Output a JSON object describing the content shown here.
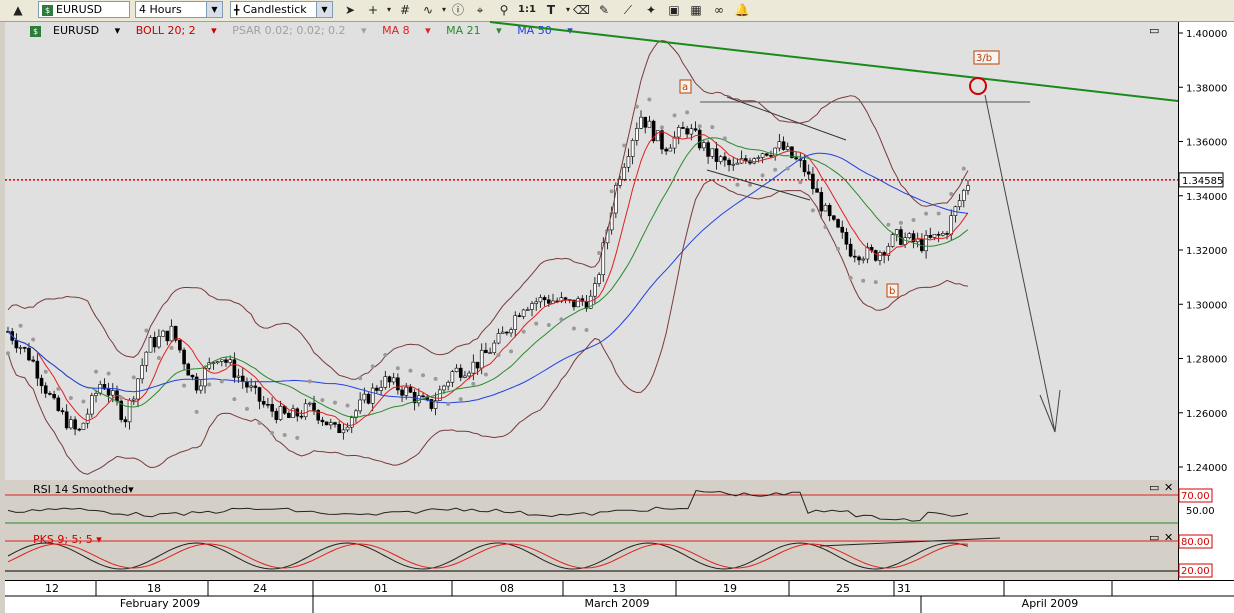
{
  "toolbar": {
    "symbol": "EURUSD",
    "timeframe": "4 Hours",
    "chart_type": "Candlestick",
    "zoom_label": "1:1"
  },
  "legend": {
    "symbol": "EURUSD",
    "boll": "BOLL 20; 2",
    "psar": "PSAR 0.02; 0.02; 0.2",
    "ma8": "MA 8",
    "ma21": "MA 21",
    "ma50": "MA 50"
  },
  "colors": {
    "boll": "#7a3a3a",
    "psar": "#9a9a9a",
    "ma8": "#e02020",
    "ma21": "#2a8a2a",
    "ma50": "#2040e0",
    "trendline": "#1a8a1a",
    "current_price": "#d00000"
  },
  "annotations": {
    "wave_a": "a",
    "wave_b": "b",
    "wave_3b": "3/b"
  },
  "current_price": "1.34585",
  "price_axis": [
    "1.40000",
    "1.38000",
    "1.36000",
    "1.34000",
    "1.32000",
    "1.30000",
    "1.28000",
    "1.26000",
    "1.24000"
  ],
  "rsi": {
    "title": "RSI 14 Smoothed",
    "levels": [
      "70.00",
      "50.00"
    ]
  },
  "pks": {
    "title": "PKS 9; 5; 5",
    "levels": [
      "80.00",
      "20.00"
    ]
  },
  "time_axis": {
    "days": [
      "12",
      "18",
      "24",
      "01",
      "08",
      "13",
      "19",
      "25",
      "31"
    ],
    "months": [
      "February 2009",
      "March 2009",
      "April 2009"
    ]
  },
  "chart_data": {
    "type": "candlestick",
    "instrument": "EURUSD",
    "interval": "4 Hours",
    "ylim": [
      1.235,
      1.405
    ],
    "current_price": 1.34585,
    "approx_close_path": [
      1.29,
      1.28,
      1.262,
      1.252,
      1.272,
      1.258,
      1.285,
      1.29,
      1.27,
      1.282,
      1.272,
      1.262,
      1.258,
      1.262,
      1.253,
      1.262,
      1.272,
      1.268,
      1.262,
      1.275,
      1.278,
      1.287,
      1.3,
      1.302,
      1.3,
      1.302,
      1.345,
      1.37,
      1.358,
      1.365,
      1.355,
      1.35,
      1.356,
      1.358,
      1.35,
      1.332,
      1.32,
      1.318,
      1.325,
      1.322,
      1.326,
      1.345
    ]
  }
}
